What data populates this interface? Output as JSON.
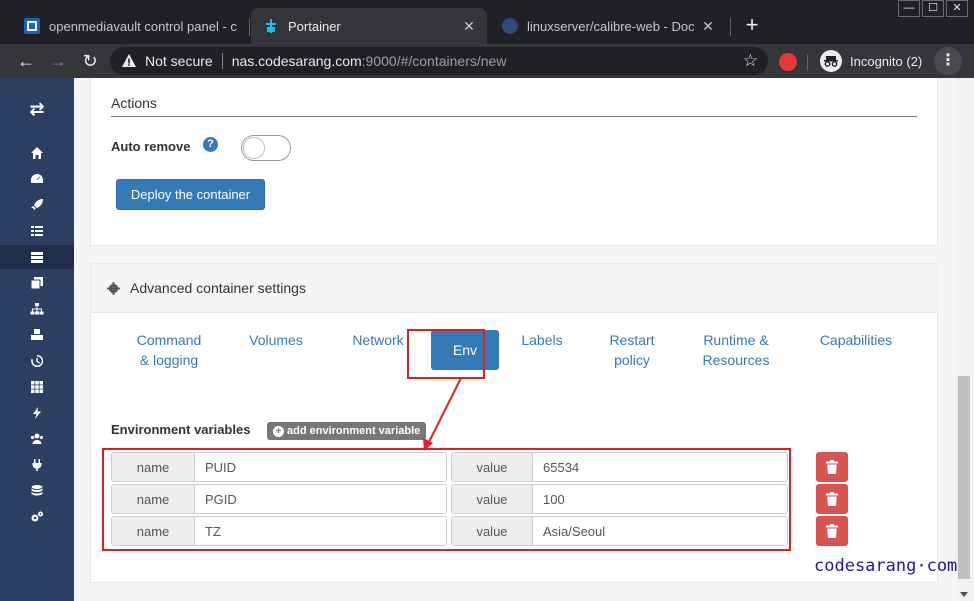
{
  "browser": {
    "tabs": [
      {
        "title": "openmediavault control panel - c",
        "favicon_color": "#1565c0"
      },
      {
        "title": "Portainer",
        "favicon_color": "#13bef9"
      },
      {
        "title": "linuxserver/calibre-web - Docker",
        "favicon_color": "#2c4a7a"
      }
    ],
    "new_tab_symbol": "+",
    "security_text": "Not secure",
    "url_host": "nas.codesarang.com",
    "url_rest": ":9000/#/containers/new",
    "incognito_label": "Incognito (2)"
  },
  "sidebar": {
    "logo_icon": "swap-arrows-icon",
    "items": [
      {
        "icon": "home-icon"
      },
      {
        "icon": "dashboard-icon"
      },
      {
        "icon": "rocket-icon"
      },
      {
        "icon": "list-icon"
      },
      {
        "icon": "server-icon",
        "active": true
      },
      {
        "icon": "clone-icon"
      },
      {
        "icon": "sitemap-icon"
      },
      {
        "icon": "cubes-icon"
      },
      {
        "icon": "history-icon"
      },
      {
        "icon": "th-icon"
      },
      {
        "icon": "bolt-icon"
      },
      {
        "icon": "users-icon"
      },
      {
        "icon": "plug-icon"
      },
      {
        "icon": "database-icon"
      },
      {
        "icon": "cogs-icon"
      }
    ]
  },
  "actions": {
    "title": "Actions",
    "auto_remove_label": "Auto remove",
    "help_symbol": "?",
    "auto_remove_enabled": false,
    "deploy_label": "Deploy the container"
  },
  "advanced": {
    "title": "Advanced container settings",
    "tabs": [
      {
        "label_line1": "Command",
        "label_line2": "& logging"
      },
      {
        "label_line1": "Volumes"
      },
      {
        "label_line1": "Network"
      },
      {
        "label_line1": "Env",
        "active": true
      },
      {
        "label_line1": "Labels"
      },
      {
        "label_line1": "Restart",
        "label_line2": "policy"
      },
      {
        "label_line1": "Runtime &",
        "label_line2": "Resources"
      },
      {
        "label_line1": "Capabilities"
      }
    ],
    "env_title": "Environment variables",
    "add_env_label": "add environment variable",
    "add_env_symbol": "+",
    "name_label": "name",
    "value_label": "value",
    "env_vars": [
      {
        "name": "PUID",
        "value": "65534"
      },
      {
        "name": "PGID",
        "value": "100"
      },
      {
        "name": "TZ",
        "value": "Asia/Seoul"
      }
    ]
  },
  "watermark": "codesarang·com",
  "colors": {
    "sidebar": "#2d3e63",
    "primary": "#337ab7",
    "danger": "#d9534f",
    "highlight": "#e02020"
  }
}
